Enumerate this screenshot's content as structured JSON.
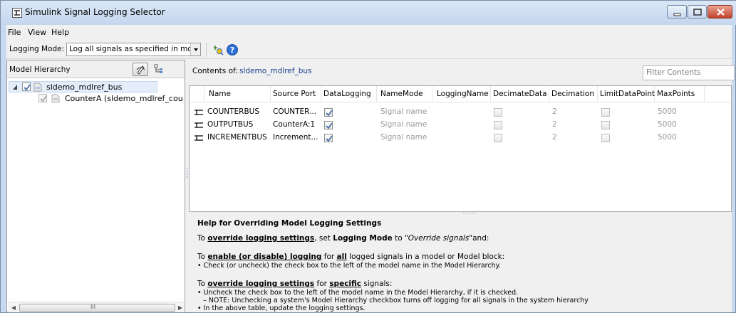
{
  "window": {
    "title": "Simulink Signal Logging Selector",
    "colors": {
      "title_bg": "#c9daf0",
      "close_red": "#c4422a",
      "link_blue": "#1a3d8a"
    }
  },
  "menu": [
    "File",
    "View",
    "Help"
  ],
  "toolbar": {
    "logging_mode_label": "Logging Mode:",
    "logging_mode_value": "Log all signals as specified in model",
    "icons": [
      "highlight-signal-icon",
      "help-icon"
    ]
  },
  "hierarchy": {
    "header": "Model Hierarchy",
    "icons": [
      "model-hierarchy-toggle-icon",
      "collapse-tree-icon"
    ],
    "items": [
      {
        "label": "sldemo_mdlref_bus",
        "checked": true,
        "expanded": true
      },
      {
        "label": "CounterA (sldemo_mdlref_cou",
        "checked": true
      }
    ],
    "scroll_mid": "III"
  },
  "contents": {
    "label": "Contents of:",
    "model": "sldemo_mdlref_bus",
    "filter_placeholder": "Filter Contents"
  },
  "table": {
    "columns": [
      "Name",
      "Source Port",
      "DataLogging",
      "NameMode",
      "LoggingName",
      "DecimateData",
      "Decimation",
      "LimitDataPoints",
      "MaxPoints"
    ],
    "rows": [
      {
        "name": "COUNTERBUS",
        "source_port": "COUNTER...",
        "data_logging": true,
        "name_mode": "Signal name",
        "logging_name": "",
        "decimate_data": false,
        "decimation": "2",
        "limit_data_points": false,
        "max_points": "5000"
      },
      {
        "name": "OUTPUTBUS",
        "source_port": "CounterA:1",
        "data_logging": true,
        "name_mode": "Signal name",
        "logging_name": "",
        "decimate_data": false,
        "decimation": "2",
        "limit_data_points": false,
        "max_points": "5000"
      },
      {
        "name": "INCREMENTBUS",
        "source_port": "Increment...",
        "data_logging": true,
        "name_mode": "Signal name",
        "logging_name": "",
        "decimate_data": false,
        "decimation": "2",
        "limit_data_points": false,
        "max_points": "5000"
      }
    ]
  },
  "help": {
    "title": "Help for Overriding Model Logging Settings",
    "p1": {
      "a": "To ",
      "b": "override logging settings",
      "c": ", set ",
      "d": "Logging Mode",
      "e": " to ",
      "f": "\"Override signals\"",
      "g": "and:"
    },
    "p2": {
      "a": "To ",
      "b": "enable (or disable) logging",
      "c": " for ",
      "d": "all",
      "e": " logged signals in a model or Model block:"
    },
    "p2_bullet": "• Check (or uncheck) the check box to the left of the model name in the Model Hierarchy.",
    "p3": {
      "a": "To ",
      "b": "override logging settings",
      "c": " for ",
      "d": "specific",
      "e": " signals:"
    },
    "p3_bullet1": "• Uncheck the check box to the left of the model name in the Model Hierarchy, if it is checked.",
    "p3_note": "– NOTE: Unchecking a system's Model Hierarchy checkbox turns off logging for all signals in the system hierarchy",
    "p3_bullet2": "• In the above table, update the logging settings."
  }
}
